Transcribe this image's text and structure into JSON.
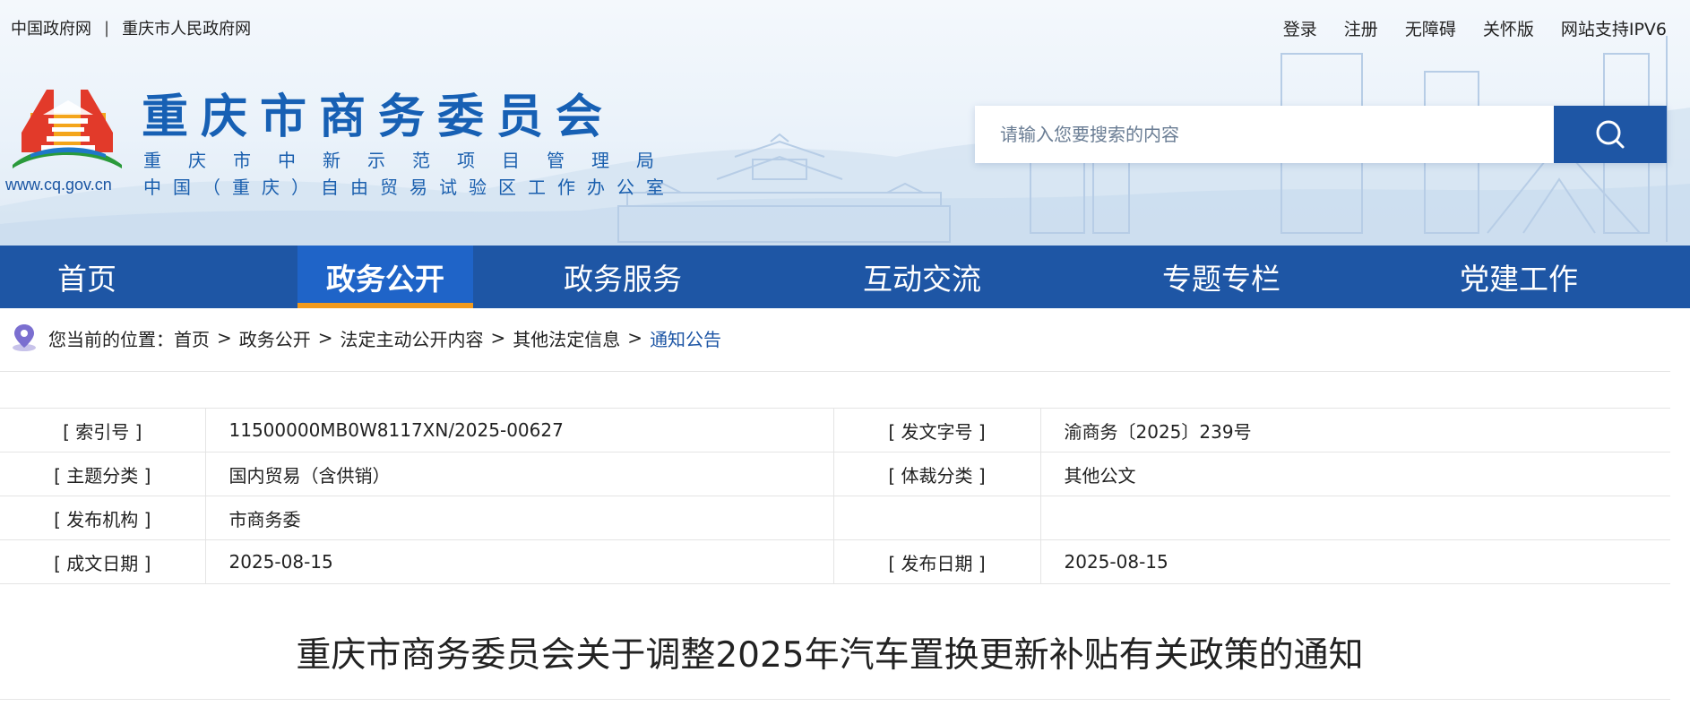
{
  "topbar": {
    "left_links": [
      "中国政府网",
      "重庆市人民政府网"
    ],
    "separator": "|",
    "right_links": [
      "登录",
      "注册",
      "无障碍",
      "关怀版",
      "网站支持IPV6"
    ]
  },
  "header": {
    "site_title": "重庆市商务委员会",
    "subtitle_1": "重庆市中新示范项目管理局",
    "subtitle_2": "中国（重庆）自由贸易试验区工作办公室",
    "logo_url": "www.cq.gov.cn"
  },
  "search": {
    "placeholder": "请输入您要搜索的内容",
    "button_icon": "search-icon"
  },
  "nav": {
    "items": [
      "首页",
      "政务公开",
      "政务服务",
      "互动交流",
      "专题专栏",
      "党建工作"
    ],
    "active": "政务公开"
  },
  "breadcrumb": {
    "prefix": "您当前的位置：",
    "items": [
      "首页",
      "政务公开",
      "法定主动公开内容",
      "其他法定信息",
      "通知公告"
    ],
    "separator": ">"
  },
  "meta": {
    "rows": [
      {
        "l1": "[ 索引号 ]",
        "v1": "11500000MB0W8117XN/2025-00627",
        "l2": "[ 发文字号 ]",
        "v2": "渝商务〔2025〕239号"
      },
      {
        "l1": "[ 主题分类 ]",
        "v1": "国内贸易（含供销）",
        "l2": "[ 体裁分类 ]",
        "v2": "其他公文"
      },
      {
        "l1": "[ 发布机构 ]",
        "v1": "市商务委",
        "l2": "",
        "v2": ""
      },
      {
        "l1": "[ 成文日期 ]",
        "v1": "2025-08-15",
        "l2": "[ 发布日期 ]",
        "v2": "2025-08-15"
      }
    ]
  },
  "article": {
    "title": "重庆市商务委员会关于调整2025年汽车置换更新补贴有关政策的通知"
  },
  "colors": {
    "nav_bg": "#1e56a5",
    "nav_active": "#1f64c8",
    "nav_active_underline": "#f19a1d",
    "title_blue": "#1760b4"
  }
}
